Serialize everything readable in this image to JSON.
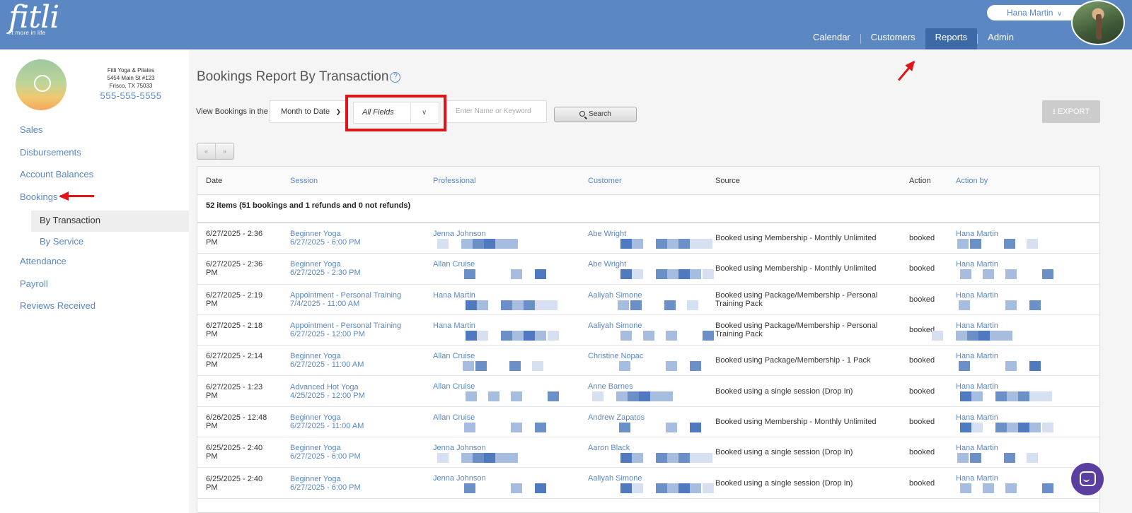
{
  "brand": {
    "logo_text": "fitli",
    "tagline": "fit more in life"
  },
  "user": {
    "name": "Hana Martin"
  },
  "nav": [
    {
      "label": "Calendar"
    },
    {
      "label": "Customers"
    },
    {
      "label": "Reports"
    },
    {
      "label": "Admin"
    }
  ],
  "business": {
    "name": "Fitli Yoga & Pilates",
    "address1": "5454 Main St #123",
    "address2": "Frisco, TX 75033",
    "phone": "555-555-5555"
  },
  "sidebar": {
    "items": [
      {
        "label": "Sales"
      },
      {
        "label": "Disbursements"
      },
      {
        "label": "Account Balances"
      },
      {
        "label": "Bookings"
      },
      {
        "label": "By Transaction"
      },
      {
        "label": "By Service"
      },
      {
        "label": "Attendance"
      },
      {
        "label": "Payroll"
      },
      {
        "label": "Reviews Received"
      }
    ]
  },
  "page": {
    "title": "Bookings Report By Transaction",
    "help_icon": "?",
    "filter_label": "View Bookings in the",
    "range_value": "Month to Date",
    "fields_value": "All Fields",
    "keyword_placeholder": "Enter Name or Keyword",
    "search_label": "Search",
    "export_label": "EXPORT",
    "pager_prev": "«",
    "pager_next": "»"
  },
  "table": {
    "headers": [
      "Date",
      "Session",
      "Professional",
      "Customer",
      "Source",
      "Action",
      "Action by"
    ],
    "summary": "52 items (51 bookings and 1 refunds and 0 not refunds)",
    "rows": [
      {
        "date": "6/27/2025 - 2:36",
        "date2": "PM",
        "session": "Beginner Yoga",
        "session_time": "6/27/2025 - 6:00 PM",
        "professional": "Jenna Johnson",
        "customer": "Abe Wright",
        "source": "Booked using Membership - Monthly Unlimited",
        "source2": "",
        "action": "booked",
        "action_by": "Hana Martin"
      },
      {
        "date": "6/27/2025 - 2:36",
        "date2": "PM",
        "session": "Beginner Yoga",
        "session_time": "6/27/2025 - 2:30 PM",
        "professional": "Allan Cruise",
        "customer": "Abe Wright",
        "source": "Booked using Membership - Monthly Unlimited",
        "source2": "",
        "action": "booked",
        "action_by": "Hana Martin"
      },
      {
        "date": "6/27/2025 - 2:19",
        "date2": "PM",
        "session": "Appointment - Personal Training",
        "session_time": "7/4/2025 - 11:00 AM",
        "professional": "Hana Martin",
        "customer": "Aaliyah Simone",
        "source": "Booked using Package/Membership - Personal",
        "source2": "Training Pack",
        "action": "booked",
        "action_by": "Hana Martin"
      },
      {
        "date": "6/27/2025 - 2:18",
        "date2": "PM",
        "session": "Appointment - Personal Training",
        "session_time": "6/27/2025 - 12:00 PM",
        "professional": "Hana Martin",
        "customer": "Aaliyah Simone",
        "source": "Booked using Package/Membership - Personal",
        "source2": "Training Pack",
        "action": "booked",
        "action_by": "Hana Martin"
      },
      {
        "date": "6/27/2025 - 2:14",
        "date2": "PM",
        "session": "Beginner Yoga",
        "session_time": "6/27/2025 - 11:00 AM",
        "professional": "Allan Cruise",
        "customer": "Christine Nopac",
        "source": "Booked using Package/Membership - 1 Pack",
        "source2": "",
        "action": "booked",
        "action_by": "Hana Martin"
      },
      {
        "date": "6/27/2025 - 1:23",
        "date2": "PM",
        "session": "Advanced Hot Yoga",
        "session_time": "4/25/2025 - 12:00 PM",
        "professional": "Allan Cruise",
        "customer": "Anne Barnes",
        "source": "Booked using a single session (Drop In)",
        "source2": "",
        "action": "booked",
        "action_by": "Hana Martin"
      },
      {
        "date": "6/26/2025 - 12:48",
        "date2": "PM",
        "session": "Beginner Yoga",
        "session_time": "6/27/2025 - 11:00 AM",
        "professional": "Allan Cruise",
        "customer": "Andrew Zapatos",
        "source": "Booked using Membership - Monthly Unlimited",
        "source2": "",
        "action": "booked",
        "action_by": "Hana Martin"
      },
      {
        "date": "6/25/2025 - 2:40",
        "date2": "PM",
        "session": "Beginner Yoga",
        "session_time": "6/27/2025 - 6:00 PM",
        "professional": "Jenna Johnson",
        "customer": "Aaron Black",
        "source": "Booked using a single session (Drop In)",
        "source2": "",
        "action": "booked",
        "action_by": "Hana Martin"
      },
      {
        "date": "6/25/2025 - 2:40",
        "date2": "PM",
        "session": "Beginner Yoga",
        "session_time": "6/27/2025 - 6:00 PM",
        "professional": "Jenna Johnson",
        "customer": "Aaliyah Simone",
        "source": "Booked using a single session (Drop In)",
        "source2": "",
        "action": "booked",
        "action_by": "Hana Martin"
      }
    ]
  },
  "colors": {
    "header": "#5b87c2",
    "link": "#5b87c2",
    "annotation": "#e0141b",
    "chat": "#5a3fa0"
  }
}
